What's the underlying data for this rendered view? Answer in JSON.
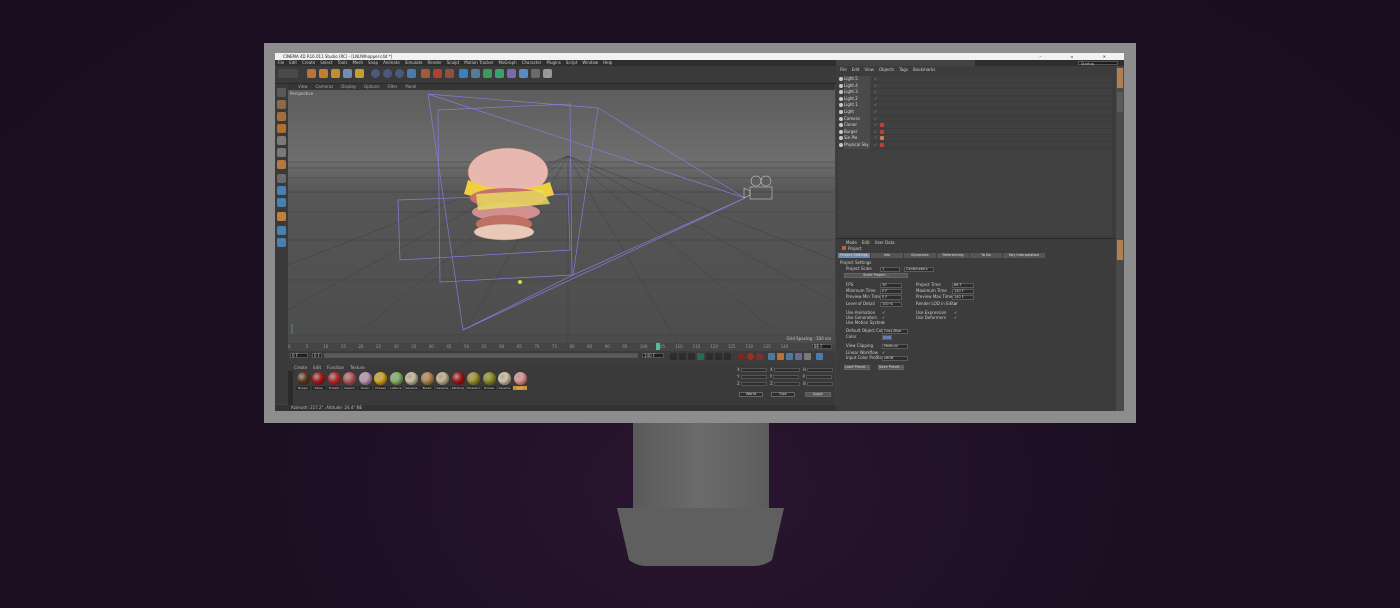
{
  "window": {
    "title": "CINEMA 4D R16.011 Studio (RC) - [LNUWhopper.c4d *]",
    "controls": "– ▫ ✕"
  },
  "menu": [
    "File",
    "Edit",
    "Create",
    "Select",
    "Tools",
    "Mesh",
    "Snap",
    "Animate",
    "Simulate",
    "Render",
    "Sculpt",
    "Motion Tracker",
    "MoGraph",
    "Character",
    "Plugins",
    "Script",
    "Window",
    "Help"
  ],
  "layout": {
    "label": "Layout:",
    "value": "Startup"
  },
  "viewport": {
    "menu": [
      "View",
      "Cameras",
      "Display",
      "Options",
      "Filter",
      "Panel"
    ],
    "label": "Perspective",
    "grid_spacing": "Grid Spacing : 100 cm"
  },
  "timeline": {
    "ticks": [
      "0",
      "5",
      "10",
      "15",
      "20",
      "25",
      "30",
      "35",
      "40",
      "45",
      "50",
      "55",
      "60",
      "65",
      "70",
      "75",
      "80",
      "85",
      "90",
      "95",
      "100",
      "105",
      "110",
      "115",
      "120",
      "125",
      "130",
      "135",
      "140"
    ],
    "current_frame": "86 F",
    "start": "0 F",
    "start2": "0 F",
    "end": "140 F",
    "end2": "140 F"
  },
  "materials": {
    "menu": [
      "Create",
      "Edit",
      "Function",
      "Texture"
    ],
    "items": [
      {
        "label": "Burger",
        "color": "#6b4020"
      },
      {
        "label": "Salsa",
        "color": "#b32020"
      },
      {
        "label": "Tomato",
        "color": "#c43030"
      },
      {
        "label": "Salami",
        "color": "#c86060"
      },
      {
        "label": "Onion",
        "color": "#c9a0c0"
      },
      {
        "label": "Cheese",
        "color": "#e6b21f"
      },
      {
        "label": "Lettuce",
        "color": "#8fc070"
      },
      {
        "label": "Sesame",
        "color": "#d8c8a8"
      },
      {
        "label": "Bread",
        "color": "#c49050"
      },
      {
        "label": "Sesame",
        "color": "#d0c0a0"
      },
      {
        "label": "Ketchup",
        "color": "#b01818"
      },
      {
        "label": "Mustard",
        "color": "#a8a030"
      },
      {
        "label": "Pickles",
        "color": "#9a9a28"
      },
      {
        "label": "Sesame",
        "color": "#e0d0b0"
      },
      {
        "label": "Salt",
        "color": "#f0a0a0"
      }
    ]
  },
  "coords": {
    "rows": [
      {
        "a": "X",
        "b": "X",
        "c": "H"
      },
      {
        "a": "Y",
        "b": "Y",
        "c": "P"
      },
      {
        "a": "Z",
        "b": "Z",
        "c": "B"
      }
    ],
    "mode1": "World",
    "mode2": "Size",
    "apply": "Apply"
  },
  "status": "Azimuth: 217.2°, Altitude: 24.4° NE",
  "objects": {
    "menu": [
      "File",
      "Edit",
      "View",
      "Objects",
      "Tags",
      "Bookmarks"
    ],
    "rows": [
      {
        "name": "Light.5"
      },
      {
        "name": "Light.4"
      },
      {
        "name": "Light.3"
      },
      {
        "name": "Light.2"
      },
      {
        "name": "Light.1"
      },
      {
        "name": "Light"
      },
      {
        "name": "Camera"
      },
      {
        "name": "Cloner"
      },
      {
        "name": "Burger"
      },
      {
        "name": "Sin Pie"
      },
      {
        "name": "Physical Sky"
      }
    ]
  },
  "attributes": {
    "menu": [
      "Mode",
      "Edit",
      "User Data"
    ],
    "object": "Project",
    "tabs": [
      "Project Settings",
      "Info",
      "Dynamics",
      "Referencing",
      "To Do",
      "Key Interpolation"
    ],
    "section": "Project Settings",
    "project_scale": {
      "label": "Project Scale",
      "value": "1",
      "unit": "Centimeters"
    },
    "scale_button": "Scale Project...",
    "fps": {
      "label": "FPS",
      "value": "30"
    },
    "project_time": {
      "label": "Project Time",
      "value": "86 F"
    },
    "min_time": {
      "label": "Minimum Time",
      "value": "0 F"
    },
    "max_time": {
      "label": "Maximum Time",
      "value": "140 F"
    },
    "preview_min": {
      "label": "Preview Min Time",
      "value": "0 F"
    },
    "preview_max": {
      "label": "Preview Max Time",
      "value": "140 F"
    },
    "lod": {
      "label": "Level of Detail",
      "value": "100 %"
    },
    "render_lod": {
      "label": "Render LOD in Editor"
    },
    "use_animation": {
      "label": "Use Animation"
    },
    "use_expression": {
      "label": "Use Expression"
    },
    "use_generators": {
      "label": "Use Generators"
    },
    "use_deformers": {
      "label": "Use Deformers"
    },
    "use_motion": {
      "label": "Use Motion System"
    },
    "default_color": {
      "label": "Default Object Color",
      "value": "Gray-Blue"
    },
    "color": {
      "label": "Color"
    },
    "view_clipping": {
      "label": "View Clipping",
      "value": "Medium"
    },
    "linear": {
      "label": "Linear Workflow"
    },
    "input_profile": {
      "label": "Input Color Profile",
      "value": "sRGB"
    },
    "load_preset": "Load Preset...",
    "save_preset": "Save Preset..."
  }
}
